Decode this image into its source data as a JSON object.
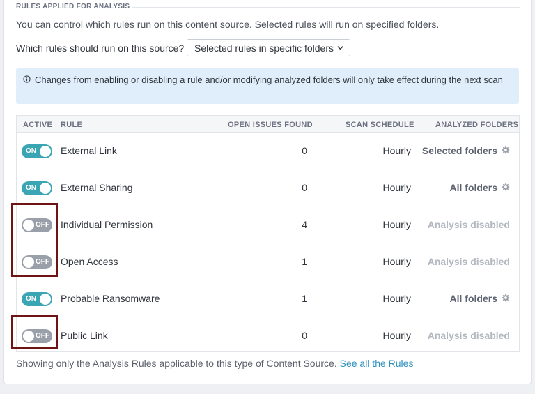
{
  "section": {
    "title": "RULES APPLIED FOR ANALYSIS",
    "description": "You can control which rules run on this content source. Selected rules will run on specified folders."
  },
  "selector": {
    "label": "Which rules should run on this source?",
    "value": "Selected rules in specific folders"
  },
  "info_banner": {
    "text": "Changes from enabling or disabling a rule and/or modifying analyzed folders will only take effect during the next scan"
  },
  "table": {
    "columns": [
      "ACTIVE",
      "RULE",
      "OPEN ISSUES FOUND",
      "SCAN SCHEDULE",
      "ANALYZED FOLDERS"
    ],
    "rows": [
      {
        "active": "ON",
        "rule": "External Link",
        "issues": "0",
        "schedule": "Hourly",
        "folders": "Selected folders",
        "folders_enabled": true
      },
      {
        "active": "ON",
        "rule": "External Sharing",
        "issues": "0",
        "schedule": "Hourly",
        "folders": "All folders",
        "folders_enabled": true
      },
      {
        "active": "OFF",
        "rule": "Individual Permission",
        "issues": "4",
        "schedule": "Hourly",
        "folders": "Analysis disabled",
        "folders_enabled": false
      },
      {
        "active": "OFF",
        "rule": "Open Access",
        "issues": "1",
        "schedule": "Hourly",
        "folders": "Analysis disabled",
        "folders_enabled": false
      },
      {
        "active": "ON",
        "rule": "Probable Ransomware",
        "issues": "1",
        "schedule": "Hourly",
        "folders": "All folders",
        "folders_enabled": true
      },
      {
        "active": "OFF",
        "rule": "Public Link",
        "issues": "0",
        "schedule": "Hourly",
        "folders": "Analysis disabled",
        "folders_enabled": false
      }
    ]
  },
  "footer": {
    "text": "Showing only the Analysis Rules applicable to this type of Content Source.",
    "link": "See all the Rules"
  },
  "colors": {
    "toggle_on": "#3aa5b3",
    "toggle_off": "#9aa0aa",
    "info_bg": "#e0eefb",
    "highlight": "#6e1414",
    "link": "#2f8fbd"
  }
}
